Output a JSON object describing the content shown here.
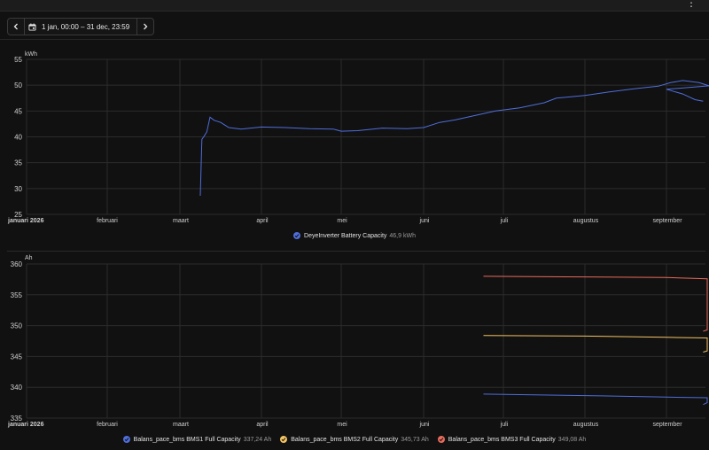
{
  "toolbar": {
    "prev_icon": "chevron-left-icon",
    "calendar_icon": "calendar-icon",
    "date_range": "1 jan, 00:00 – 31 dec, 23:59",
    "next_icon": "chevron-right-icon"
  },
  "chart_data": [
    {
      "type": "line",
      "ylabel": "kWh",
      "ylim": [
        25,
        55
      ],
      "yticks": [
        25,
        30,
        35,
        40,
        45,
        50,
        55
      ],
      "xlabels": [
        "januari 2026",
        "februari",
        "maart",
        "april",
        "mei",
        "juni",
        "juli",
        "augustus",
        "september"
      ],
      "grid": true,
      "legend": "bottom",
      "series": [
        {
          "name": "DeyeInverter Battery Capacity",
          "value_label": "46,9 kWh",
          "color": "#4f6edb",
          "points": [
            [
              2.25,
              28.6
            ],
            [
              2.27,
              39.5
            ],
            [
              2.3,
              40.2
            ],
            [
              2.33,
              41.0
            ],
            [
              2.37,
              43.8
            ],
            [
              2.42,
              43.2
            ],
            [
              2.5,
              42.8
            ],
            [
              2.6,
              41.8
            ],
            [
              2.75,
              41.5
            ],
            [
              3.0,
              41.9
            ],
            [
              3.3,
              41.8
            ],
            [
              3.6,
              41.6
            ],
            [
              3.9,
              41.5
            ],
            [
              4.0,
              41.1
            ],
            [
              4.2,
              41.2
            ],
            [
              4.5,
              41.7
            ],
            [
              4.8,
              41.6
            ],
            [
              5.0,
              41.8
            ],
            [
              5.2,
              42.8
            ],
            [
              5.4,
              43.3
            ],
            [
              5.6,
              44.0
            ],
            [
              5.9,
              45.0
            ],
            [
              6.2,
              45.6
            ],
            [
              6.5,
              46.6
            ],
            [
              6.65,
              47.5
            ],
            [
              7.0,
              48.0
            ],
            [
              7.3,
              48.7
            ],
            [
              7.6,
              49.3
            ],
            [
              7.9,
              49.8
            ],
            [
              8.05,
              50.5
            ],
            [
              8.2,
              50.9
            ],
            [
              8.4,
              50.5
            ],
            [
              8.6,
              49.5
            ],
            [
              8.75,
              50.1
            ],
            [
              8.85,
              50.3
            ],
            [
              9.0,
              49.2
            ],
            [
              9.2,
              48.3
            ],
            [
              9.35,
              47.2
            ],
            [
              9.45,
              46.9
            ]
          ]
        }
      ]
    },
    {
      "type": "line",
      "ylabel": "Ah",
      "ylim": [
        335,
        360
      ],
      "yticks": [
        335,
        340,
        345,
        350,
        355,
        360
      ],
      "xlabels": [
        "januari 2026",
        "februari",
        "maart",
        "april",
        "mei",
        "juni",
        "juli",
        "augustus",
        "september"
      ],
      "grid": true,
      "legend": "bottom",
      "series": [
        {
          "name": "Balans_pace_bms BMS1 Full Capacity",
          "value_label": "337,24 Ah",
          "color": "#4f6edb",
          "points": [
            [
              5.75,
              338.9
            ],
            [
              7.2,
              338.6
            ],
            [
              8.0,
              338.4
            ],
            [
              8.5,
              338.3
            ],
            [
              8.5,
              337.5
            ],
            [
              9.45,
              337.2
            ]
          ]
        },
        {
          "name": "Balans_pace_bms BMS2 Full Capacity",
          "value_label": "345,73 Ah",
          "color": "#f3c263",
          "points": [
            [
              5.75,
              348.4
            ],
            [
              7.0,
              348.3
            ],
            [
              8.0,
              348.1
            ],
            [
              8.5,
              348.0
            ],
            [
              8.5,
              345.9
            ],
            [
              9.45,
              345.7
            ]
          ]
        },
        {
          "name": "Balans_pace_bms BMS3 Full Capacity",
          "value_label": "349,08 Ah",
          "color": "#e86a5b",
          "points": [
            [
              5.75,
              358.0
            ],
            [
              7.0,
              357.9
            ],
            [
              8.0,
              357.8
            ],
            [
              8.5,
              357.6
            ],
            [
              8.5,
              349.3
            ],
            [
              9.45,
              349.1
            ]
          ]
        }
      ]
    }
  ]
}
